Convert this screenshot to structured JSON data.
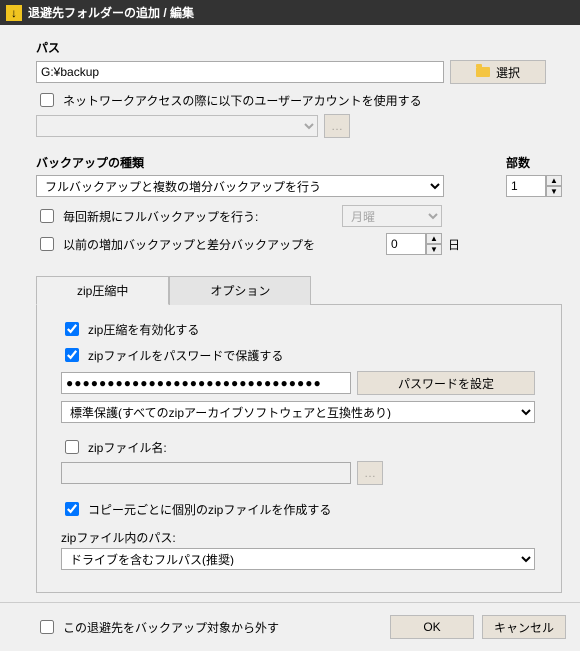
{
  "window": {
    "title": "退避先フォルダーの追加 / 編集"
  },
  "path": {
    "label": "パス",
    "value": "G:¥backup",
    "browse": "選択"
  },
  "network": {
    "use_account": "ネットワークアクセスの際に以下のユーザーアカウントを使用する",
    "account_value": ""
  },
  "backup_type": {
    "label": "バックアップの種類",
    "selected": "フルバックアップと複数の増分バックアップを行う",
    "copies_label": "部数",
    "copies_value": "1",
    "full_each_time": "毎回新規にフルバックアップを行う:",
    "day_selected": "月曜",
    "keep_prev": "以前の増加バックアップと差分バックアップを",
    "keep_value": "0",
    "days_suffix": "日"
  },
  "tabs": {
    "zip": "zip圧縮中",
    "options": "オプション"
  },
  "zip": {
    "enable": "zip圧縮を有効化する",
    "protect": "zipファイルをパスワードで保護する",
    "password": "●●●●●●●●●●●●●●●●●●●●●●●●●●●●●●●",
    "set_password": "パスワードを設定",
    "protection_mode": "標準保護(すべてのzipアーカイブソフトウェアと互換性あり)",
    "filename_label": "zipファイル名:",
    "filename_value": "",
    "per_source": "コピー元ごとに個別のzipファイルを作成する",
    "inner_path_label": "zipファイル内のパス:",
    "inner_path_value": "ドライブを含むフルパス(推奨)"
  },
  "footer": {
    "exclude": "この退避先をバックアップ対象から外す",
    "ok": "OK",
    "cancel": "キャンセル"
  }
}
